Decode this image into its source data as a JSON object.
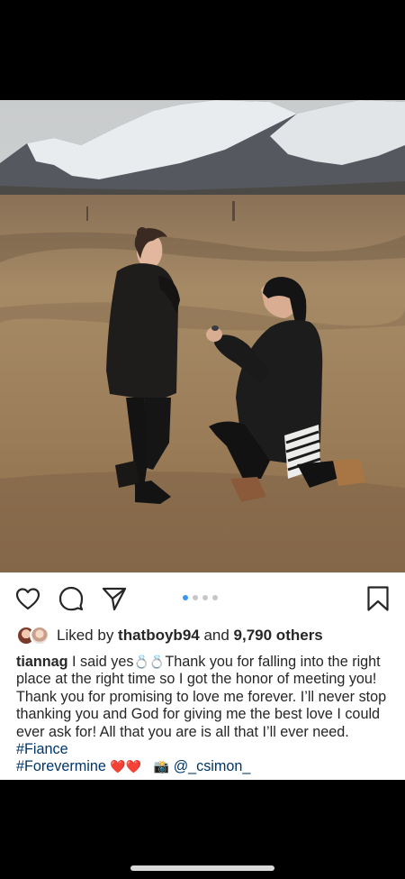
{
  "post": {
    "image_alt": "photo-proposal",
    "carousel": {
      "count": 4,
      "active": 0
    },
    "actions": {
      "like_icon": "heart-icon",
      "comment_icon": "comment-icon",
      "share_icon": "send-icon",
      "save_icon": "bookmark-icon"
    },
    "likes": {
      "prefix": "Liked by ",
      "user": "thatboyb94",
      "middle": " and ",
      "count": "9,790 others"
    },
    "caption": {
      "username": "tiannag",
      "text_1": " I said yes",
      "rings": "💍💍",
      "text_2": "Thank you for falling into the right place at the right time so I got the honor of meeting you! Thank you for promising to love me forever. I’ll never stop thanking you and God for giving me the best love I could ever ask for! All that you are is all that I’ll ever need. ",
      "hashtag_1": "#Fiance",
      "hashtag_2": "#Forevermine",
      "hearts": "❤️❤️",
      "camera": "📸",
      "mention": "@_csimon_"
    }
  },
  "colors": {
    "accent_blue": "#3897f0",
    "link": "#003569",
    "text": "#262626"
  }
}
